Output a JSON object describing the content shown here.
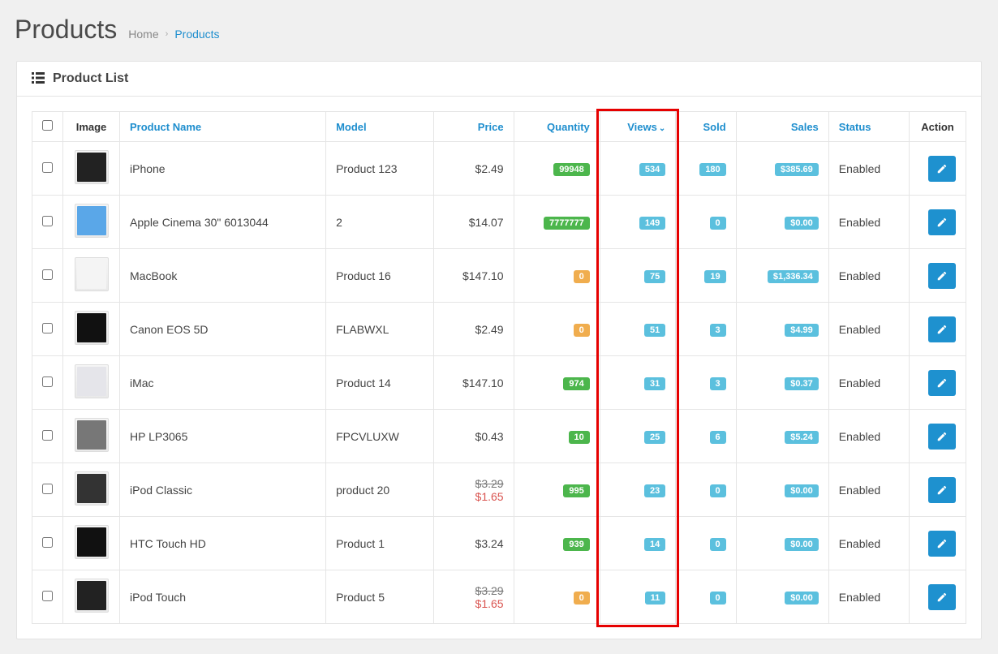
{
  "page": {
    "title": "Products"
  },
  "breadcrumb": {
    "home": "Home",
    "current": "Products"
  },
  "panel": {
    "title": "Product List"
  },
  "columns": {
    "image": "Image",
    "product_name": "Product Name",
    "model": "Model",
    "price": "Price",
    "quantity": "Quantity",
    "views": "Views",
    "sold": "Sold",
    "sales": "Sales",
    "status": "Status",
    "action": "Action"
  },
  "sort": {
    "column": "views",
    "dir": "desc"
  },
  "statuses": {
    "enabled": "Enabled"
  },
  "rows": [
    {
      "name": "iPhone",
      "model": "Product 123",
      "price": "$2.49",
      "price_special": null,
      "qty": "99948",
      "qty_style": "green",
      "views": "534",
      "sold": "180",
      "sales": "$385.69",
      "status": "Enabled",
      "thumb_bg": "#222"
    },
    {
      "name": "Apple Cinema 30\" 6013044",
      "model": "2",
      "price": "$14.07",
      "price_special": null,
      "qty": "7777777",
      "qty_style": "green",
      "views": "149",
      "sold": "0",
      "sales": "$0.00",
      "status": "Enabled",
      "thumb_bg": "#5aa7e8"
    },
    {
      "name": "MacBook",
      "model": "Product 16",
      "price": "$147.10",
      "price_special": null,
      "qty": "0",
      "qty_style": "orange",
      "views": "75",
      "sold": "19",
      "sales": "$1,336.34",
      "status": "Enabled",
      "thumb_bg": "#f4f4f4"
    },
    {
      "name": "Canon EOS 5D",
      "model": "FLABWXL",
      "price": "$2.49",
      "price_special": null,
      "qty": "0",
      "qty_style": "orange",
      "views": "51",
      "sold": "3",
      "sales": "$4.99",
      "status": "Enabled",
      "thumb_bg": "#111"
    },
    {
      "name": "iMac",
      "model": "Product 14",
      "price": "$147.10",
      "price_special": null,
      "qty": "974",
      "qty_style": "green",
      "views": "31",
      "sold": "3",
      "sales": "$0.37",
      "status": "Enabled",
      "thumb_bg": "#e5e5ea"
    },
    {
      "name": "HP LP3065",
      "model": "FPCVLUXW",
      "price": "$0.43",
      "price_special": null,
      "qty": "10",
      "qty_style": "green",
      "views": "25",
      "sold": "6",
      "sales": "$5.24",
      "status": "Enabled",
      "thumb_bg": "#777"
    },
    {
      "name": "iPod Classic",
      "model": "product 20",
      "price": "$3.29",
      "price_special": "$1.65",
      "qty": "995",
      "qty_style": "green",
      "views": "23",
      "sold": "0",
      "sales": "$0.00",
      "status": "Enabled",
      "thumb_bg": "#333"
    },
    {
      "name": "HTC Touch HD",
      "model": "Product 1",
      "price": "$3.24",
      "price_special": null,
      "qty": "939",
      "qty_style": "green",
      "views": "14",
      "sold": "0",
      "sales": "$0.00",
      "status": "Enabled",
      "thumb_bg": "#111"
    },
    {
      "name": "iPod Touch",
      "model": "Product 5",
      "price": "$3.29",
      "price_special": "$1.65",
      "qty": "0",
      "qty_style": "orange",
      "views": "11",
      "sold": "0",
      "sales": "$0.00",
      "status": "Enabled",
      "thumb_bg": "#222"
    }
  ],
  "highlight": {
    "column": "views"
  }
}
